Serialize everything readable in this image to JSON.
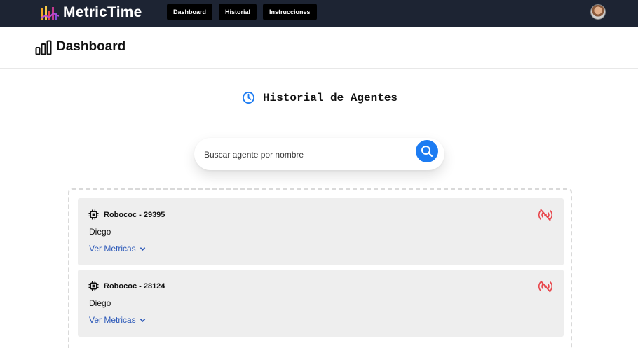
{
  "app": {
    "name": "MetricTime",
    "brand_color": "#1d2433",
    "accent_color": "#1d7cf2"
  },
  "nav": {
    "items": [
      {
        "label": "Dashboard"
      },
      {
        "label": "Historial"
      },
      {
        "label": "Instrucciones"
      }
    ]
  },
  "page": {
    "title": "Dashboard",
    "icon": "bar-chart-icon"
  },
  "section": {
    "title": "Historial de Agentes",
    "icon": "clock-icon"
  },
  "search": {
    "placeholder": "Buscar agente por nombre",
    "value": "",
    "icon": "search-icon"
  },
  "agents": [
    {
      "name": "Robococ - 29395",
      "user": "Diego",
      "link": "Ver Metricas",
      "status_icon": "signal-off-icon",
      "status_color": "#e8474c"
    },
    {
      "name": "Robococ - 28124",
      "user": "Diego",
      "link": "Ver Metricas",
      "status_icon": "signal-off-icon",
      "status_color": "#e8474c"
    }
  ]
}
